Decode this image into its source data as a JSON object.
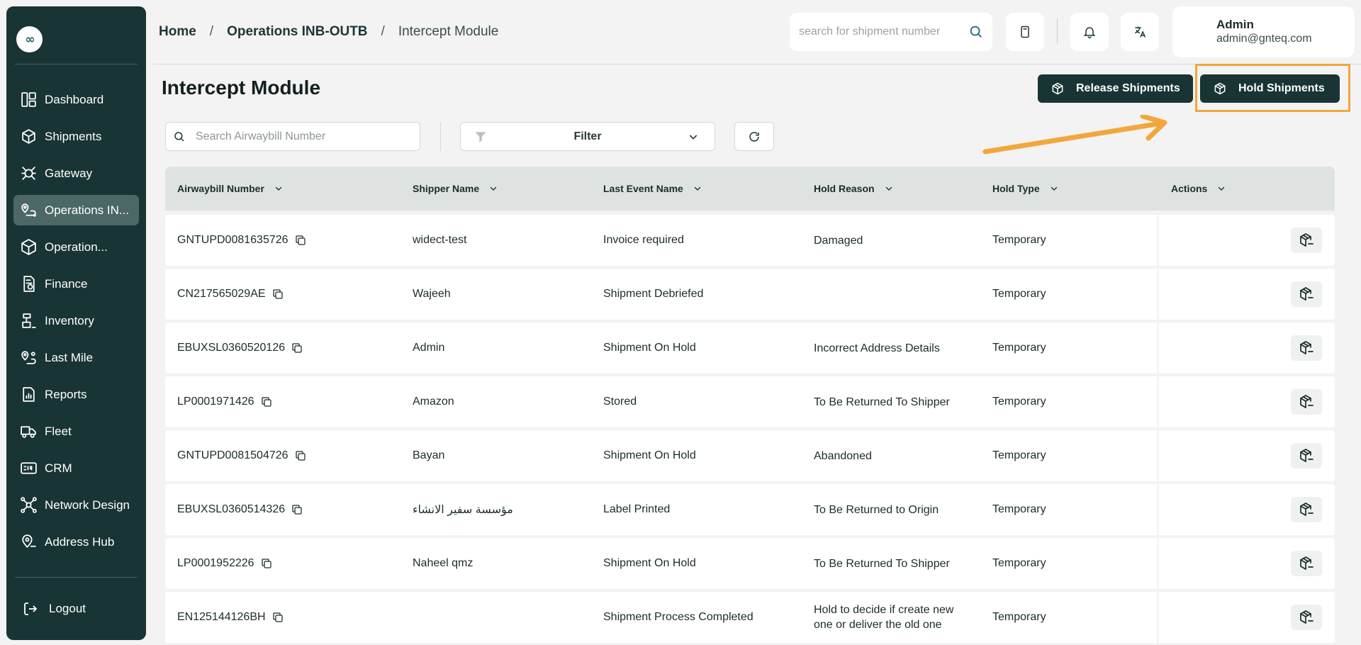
{
  "sidebar": {
    "logo": "∞",
    "items": [
      {
        "label": "Dashboard",
        "icon": "dashboard-icon",
        "active": false
      },
      {
        "label": "Shipments",
        "icon": "package-icon",
        "active": false
      },
      {
        "label": "Gateway",
        "icon": "gateway-icon",
        "active": false
      },
      {
        "label": "Operations IN...",
        "icon": "map-pin-route-icon",
        "active": true
      },
      {
        "label": "Operation...",
        "icon": "cube-icon",
        "active": false
      },
      {
        "label": "Finance",
        "icon": "invoice-icon",
        "active": false
      },
      {
        "label": "Inventory",
        "icon": "inventory-icon",
        "active": false
      },
      {
        "label": "Last Mile",
        "icon": "route-icon",
        "active": false
      },
      {
        "label": "Reports",
        "icon": "report-icon",
        "active": false
      },
      {
        "label": "Fleet",
        "icon": "truck-icon",
        "active": false
      },
      {
        "label": "CRM",
        "icon": "crm-icon",
        "active": false
      },
      {
        "label": "Network Design",
        "icon": "network-icon",
        "active": false
      },
      {
        "label": "Address Hub",
        "icon": "location-icon",
        "active": false
      }
    ],
    "logout_label": "Logout"
  },
  "header": {
    "breadcrumb": [
      "Home",
      "Operations INB-OUTB",
      "Intercept Module"
    ],
    "search_placeholder": "search for shipment number",
    "user": {
      "name": "Admin",
      "email": "admin@gnteq.com"
    }
  },
  "page": {
    "title": "Intercept Module",
    "release_label": "Release Shipments",
    "hold_label": "Hold Shipments",
    "awb_search_placeholder": "Search Airwaybill Number",
    "filter_label": "Filter"
  },
  "table": {
    "columns": [
      "Airwaybill Number",
      "Shipper Name",
      "Last Event Name",
      "Hold Reason",
      "Hold Type",
      "Actions"
    ],
    "rows": [
      {
        "awb": "GNTUPD0081635726",
        "shipper": "widect-test",
        "event": "Invoice required",
        "reason": "Damaged",
        "type": "Temporary"
      },
      {
        "awb": "CN217565029AE",
        "shipper": "Wajeeh",
        "event": "Shipment Debriefed",
        "reason": "",
        "type": "Temporary"
      },
      {
        "awb": "EBUXSL0360520126",
        "shipper": "Admin",
        "event": "Shipment On Hold",
        "reason": "Incorrect Address Details",
        "type": "Temporary"
      },
      {
        "awb": "LP0001971426",
        "shipper": "Amazon",
        "event": "Stored",
        "reason": "To Be Returned To Shipper",
        "type": "Temporary"
      },
      {
        "awb": "GNTUPD0081504726",
        "shipper": "Bayan",
        "event": "Shipment On Hold",
        "reason": "Abandoned",
        "type": "Temporary"
      },
      {
        "awb": "EBUXSL0360514326",
        "shipper": "مؤسسة سفير الانشاء",
        "event": "Label Printed",
        "reason": "To Be Returned to Origin",
        "type": "Temporary"
      },
      {
        "awb": "LP0001952226",
        "shipper": "Naheel qmz",
        "event": "Shipment On Hold",
        "reason": "To Be Returned To Shipper",
        "type": "Temporary"
      },
      {
        "awb": "EN125144126BH",
        "shipper": "",
        "event": "Shipment Process Completed",
        "reason": "Hold to decide if create new one or deliver the old one",
        "type": "Temporary"
      }
    ]
  },
  "colors": {
    "sidebar_bg": "#193434",
    "accent_dark": "#193434",
    "highlight": "#f2a73c"
  }
}
